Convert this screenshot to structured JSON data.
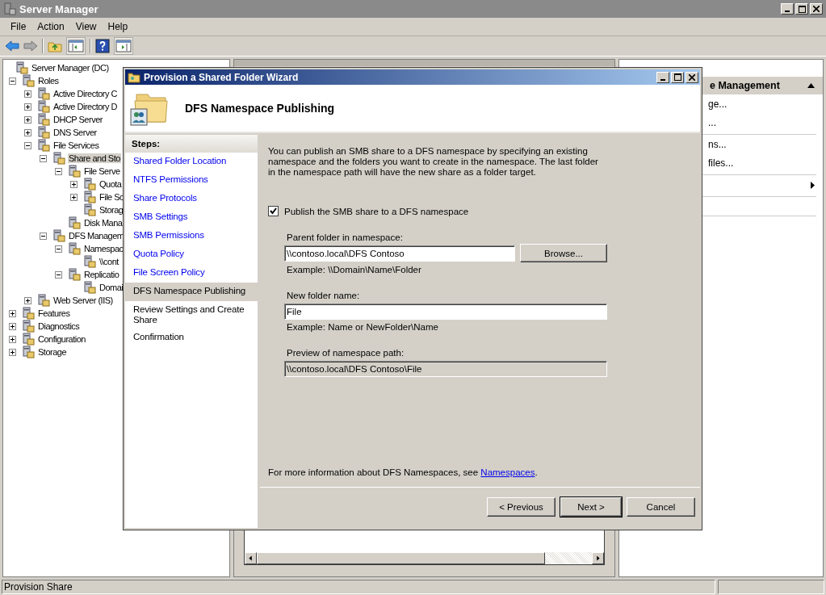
{
  "window": {
    "title": "Server Manager"
  },
  "menu": [
    "File",
    "Action",
    "View",
    "Help"
  ],
  "tree": {
    "label": "Server Manager (DC)",
    "children": [
      {
        "label": "Roles",
        "expanded": true,
        "selected": false,
        "children": [
          {
            "label": "Active Directory C",
            "expanded": false,
            "selected": false
          },
          {
            "label": "Active Directory D",
            "expanded": false,
            "selected": false
          },
          {
            "label": "DHCP Server",
            "expanded": false,
            "selected": false
          },
          {
            "label": "DNS Server",
            "expanded": false,
            "selected": false
          },
          {
            "label": "File Services",
            "expanded": true,
            "selected": false,
            "children": [
              {
                "label": "Share and Sto",
                "expanded": true,
                "selected": true,
                "children": [
                  {
                    "label": "File Serve",
                    "expanded": true,
                    "selected": false,
                    "children": [
                      {
                        "label": "Quota",
                        "expanded": false,
                        "selected": false
                      },
                      {
                        "label": "File Sc",
                        "expanded": false,
                        "selected": false
                      },
                      {
                        "label": "Storag",
                        "selected": false
                      }
                    ]
                  },
                  {
                    "label": "Disk Mana",
                    "selected": false
                  }
                ]
              },
              {
                "label": "DFS Managem",
                "expanded": true,
                "selected": false,
                "children": [
                  {
                    "label": "Namespac",
                    "expanded": true,
                    "selected": false,
                    "children": [
                      {
                        "label": "\\\\cont",
                        "selected": false
                      }
                    ]
                  },
                  {
                    "label": "Replicatio",
                    "expanded": true,
                    "selected": false,
                    "children": [
                      {
                        "label": "Domai",
                        "selected": false
                      }
                    ]
                  }
                ]
              }
            ]
          },
          {
            "label": "Web Server (IIS)",
            "expanded": false,
            "selected": false
          }
        ]
      },
      {
        "label": "Features",
        "expanded": false,
        "selected": false
      },
      {
        "label": "Diagnostics",
        "expanded": false,
        "selected": false
      },
      {
        "label": "Configuration",
        "expanded": false,
        "selected": false
      },
      {
        "label": "Storage",
        "expanded": false,
        "selected": false
      }
    ]
  },
  "actions": {
    "header": "e Management",
    "expanded": true,
    "groups": [
      [
        {
          "kind": "link",
          "label": "ge..."
        },
        {
          "kind": "link",
          "label": "..."
        }
      ],
      [
        {
          "kind": "link",
          "label": "ns..."
        },
        {
          "kind": "link",
          "label": "files..."
        }
      ],
      [
        {
          "kind": "submenu"
        }
      ]
    ]
  },
  "status_bar": "Provision Share",
  "dialog": {
    "title": "Provision a Shared Folder Wizard",
    "heading": "DFS Namespace Publishing",
    "steps_title": "Steps:",
    "steps": [
      {
        "label": "Shared Folder Location",
        "completed": true,
        "selected": false
      },
      {
        "label": "NTFS Permissions",
        "completed": true,
        "selected": false
      },
      {
        "label": "Share Protocols",
        "completed": true,
        "selected": false
      },
      {
        "label": "SMB Settings",
        "completed": true,
        "selected": false
      },
      {
        "label": "SMB Permissions",
        "completed": true,
        "selected": false
      },
      {
        "label": "Quota Policy",
        "completed": true,
        "selected": false
      },
      {
        "label": "File Screen Policy",
        "completed": true,
        "selected": false
      },
      {
        "label": "DFS Namespace Publishing",
        "completed": false,
        "selected": true
      },
      {
        "label": "Review Settings and Create Share",
        "completed": false,
        "selected": false
      },
      {
        "label": "Confirmation",
        "completed": false,
        "selected": false
      }
    ],
    "description": "You can publish an SMB share to a DFS namespace by specifying an existing namespace and the folders you want to create in the namespace. The last folder in the namespace path will have the new share as a folder target.",
    "publish": {
      "label": "Publish the SMB share to a DFS namespace",
      "checked": true
    },
    "parent_folder": {
      "label": "Parent folder in namespace:",
      "value": "\\\\contoso.local\\DFS Contoso",
      "button": "Browse...",
      "example": "Example: \\\\Domain\\Name\\Folder"
    },
    "new_folder": {
      "label": "New folder name:",
      "value": "File",
      "example": "Example: Name or NewFolder\\Name"
    },
    "preview": {
      "label": "Preview of namespace path:",
      "value": "\\\\contoso.local\\DFS Contoso\\File",
      "disabled": true
    },
    "more_info": {
      "text": "For more information about DFS Namespaces, see ",
      "link": "Namespaces",
      "after": "."
    },
    "buttons": [
      {
        "label": "< Previous",
        "default": false
      },
      {
        "label": "Next >",
        "default": true
      },
      {
        "label": "Cancel",
        "default": false
      }
    ]
  }
}
